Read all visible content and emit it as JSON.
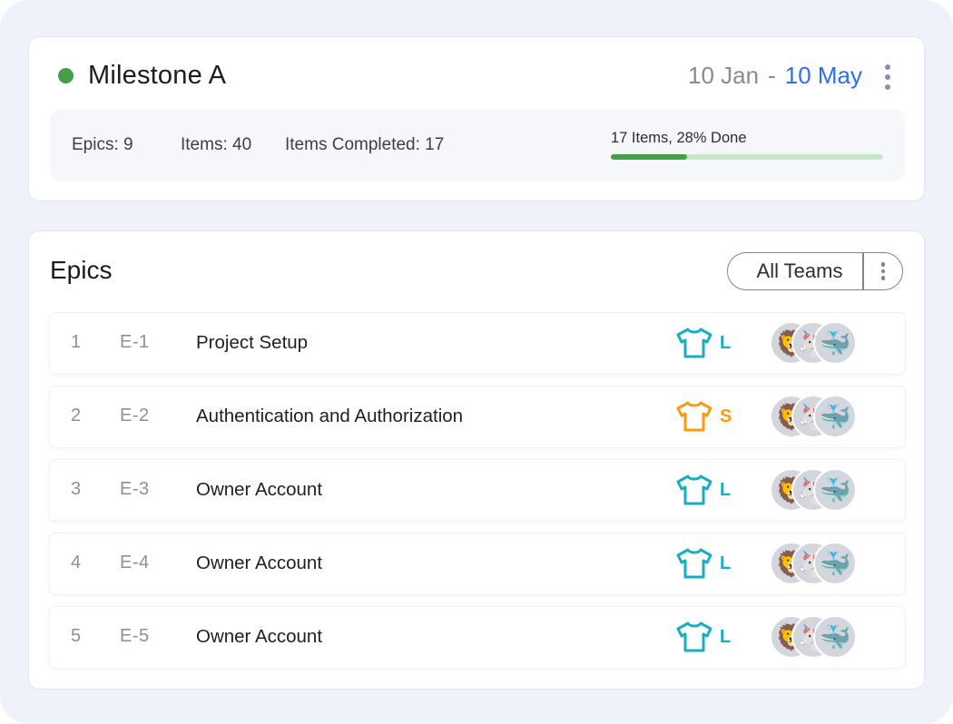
{
  "milestone": {
    "title": "Milestone A",
    "status_color": "#43a047",
    "date_start": "10 Jan",
    "date_separator": "-",
    "date_end": "10 May",
    "stats": {
      "epics": "Epics: 9",
      "items": "Items: 40",
      "items_completed": "Items Completed: 17"
    },
    "progress": {
      "label": "17 Items, 28% Done",
      "percent": 28
    },
    "menu_icon": "kebab-vertical-icon"
  },
  "epics": {
    "title": "Epics",
    "filter_label": "All Teams",
    "filter_menu_icon": "kebab-vertical-icon",
    "size_colors": {
      "L": "#17aec4",
      "S": "#fb9a0c"
    },
    "rows": [
      {
        "index": "1",
        "key": "E-1",
        "name": "Project Setup",
        "size": "L",
        "size_icon": "tshirt-icon",
        "avatars": [
          "🦁",
          "🦄",
          "🐳"
        ]
      },
      {
        "index": "2",
        "key": "E-2",
        "name": "Authentication and Authorization",
        "size": "S",
        "size_icon": "tshirt-icon",
        "avatars": [
          "🦁",
          "🦄",
          "🐳"
        ]
      },
      {
        "index": "3",
        "key": "E-3",
        "name": "Owner Account",
        "size": "L",
        "size_icon": "tshirt-icon",
        "avatars": [
          "🦁",
          "🦄",
          "🐳"
        ]
      },
      {
        "index": "4",
        "key": "E-4",
        "name": "Owner Account",
        "size": "L",
        "size_icon": "tshirt-icon",
        "avatars": [
          "🦁",
          "🦄",
          "🐳"
        ]
      },
      {
        "index": "5",
        "key": "E-5",
        "name": "Owner Account",
        "size": "L",
        "size_icon": "tshirt-icon",
        "avatars": [
          "🦁",
          "🦄",
          "🐳"
        ]
      }
    ]
  }
}
